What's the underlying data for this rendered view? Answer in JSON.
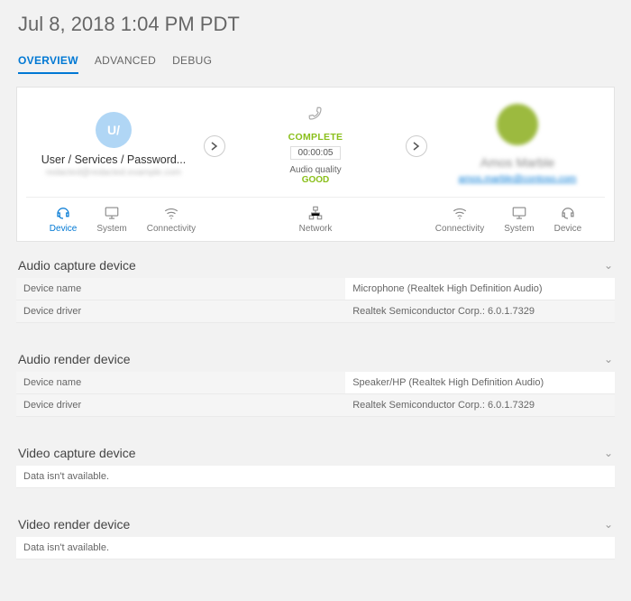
{
  "header": {
    "title": "Jul 8, 2018 1:04 PM PDT"
  },
  "tabs": [
    {
      "label": "OVERVIEW",
      "active": true
    },
    {
      "label": "ADVANCED",
      "active": false
    },
    {
      "label": "DEBUG",
      "active": false
    }
  ],
  "call": {
    "left": {
      "avatar_initial": "U/",
      "name": "User / Services / Password...",
      "sub": "redacted@redacted.example.com"
    },
    "middle": {
      "status": "COMPLETE",
      "duration": "00:00:05",
      "audio_quality_label": "Audio quality",
      "audio_quality_value": "GOOD"
    },
    "right": {
      "name": "Amos Marble",
      "link": "amos.marble@contoso.com"
    },
    "left_icons": [
      {
        "label": "Device",
        "active": true
      },
      {
        "label": "System",
        "active": false
      },
      {
        "label": "Connectivity",
        "active": false
      }
    ],
    "center_icons": [
      {
        "label": "Network",
        "active": false
      }
    ],
    "right_icons": [
      {
        "label": "Connectivity",
        "active": false
      },
      {
        "label": "System",
        "active": false
      },
      {
        "label": "Device",
        "active": false
      }
    ]
  },
  "sections": {
    "audio_capture": {
      "title": "Audio capture device",
      "rows": [
        {
          "k": "Device name",
          "v": "Microphone (Realtek High Definition Audio)"
        },
        {
          "k": "Device driver",
          "v": "Realtek Semiconductor Corp.: 6.0.1.7329"
        }
      ]
    },
    "audio_render": {
      "title": "Audio render device",
      "rows": [
        {
          "k": "Device name",
          "v": "Speaker/HP (Realtek High Definition Audio)"
        },
        {
          "k": "Device driver",
          "v": "Realtek Semiconductor Corp.: 6.0.1.7329"
        }
      ]
    },
    "video_capture": {
      "title": "Video capture device",
      "empty": "Data isn't available."
    },
    "video_render": {
      "title": "Video render device",
      "empty": "Data isn't available."
    }
  }
}
